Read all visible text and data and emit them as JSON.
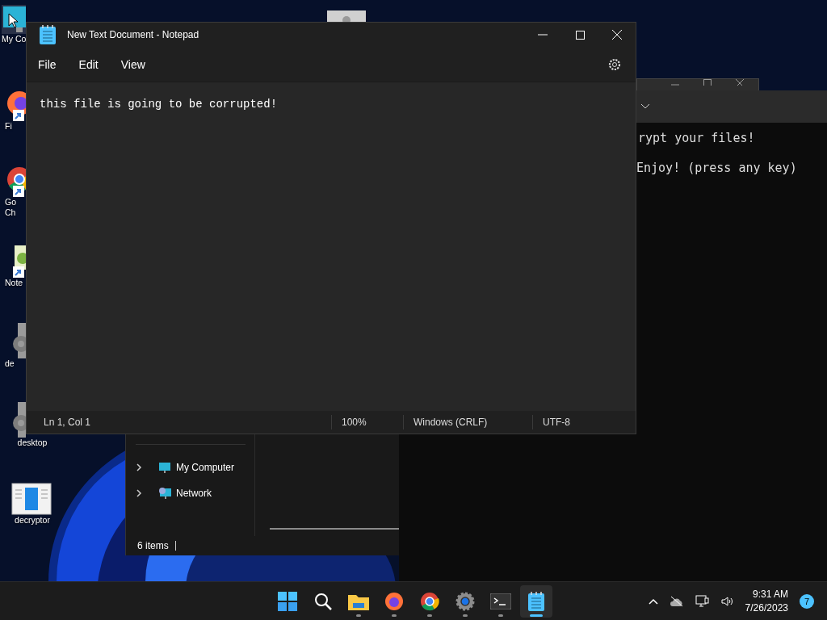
{
  "desktop_icons": [
    {
      "label": "My Co",
      "kind": "monitor",
      "selected": true
    },
    {
      "label": "Fi",
      "kind": "firefox",
      "selected": false
    },
    {
      "label": "Go Ch",
      "kind": "chrome",
      "selected": false
    },
    {
      "label": "Note",
      "kind": "notepadpp",
      "selected": false
    },
    {
      "label": "de",
      "kind": "gear",
      "selected": false
    },
    {
      "label": "desktop",
      "kind": "gear",
      "selected": false
    },
    {
      "label": "decryptor",
      "kind": "doc",
      "selected": false
    }
  ],
  "terminal": {
    "lines": [
      "rypt your files!",
      "Enjoy! (press any key)"
    ]
  },
  "explorer": {
    "nav_items": [
      {
        "label": "My Computer",
        "kind": "monitor",
        "expanded": false
      },
      {
        "label": "Network",
        "kind": "network",
        "expanded": false
      }
    ],
    "status": "6 items"
  },
  "notepad": {
    "title": "New Text Document - Notepad",
    "menu": [
      "File",
      "Edit",
      "View"
    ],
    "text": "this file is going to be corrupted!",
    "status": [
      "Ln 1, Col 1",
      "100%",
      "Windows (CRLF)",
      "UTF-8"
    ]
  },
  "taskbar": {
    "apps": [
      {
        "kind": "start",
        "running": false,
        "selected": false
      },
      {
        "kind": "search",
        "running": false,
        "selected": false
      },
      {
        "kind": "folder",
        "running": true,
        "selected": false
      },
      {
        "kind": "firefox",
        "running": true,
        "selected": false
      },
      {
        "kind": "chrome",
        "running": true,
        "selected": false
      },
      {
        "kind": "settings",
        "running": true,
        "selected": false
      },
      {
        "kind": "terminal",
        "running": true,
        "selected": false
      },
      {
        "kind": "notepad",
        "running": true,
        "selected": true
      }
    ],
    "time": "9:31 AM",
    "date": "7/26/2023",
    "notifications": "7"
  }
}
